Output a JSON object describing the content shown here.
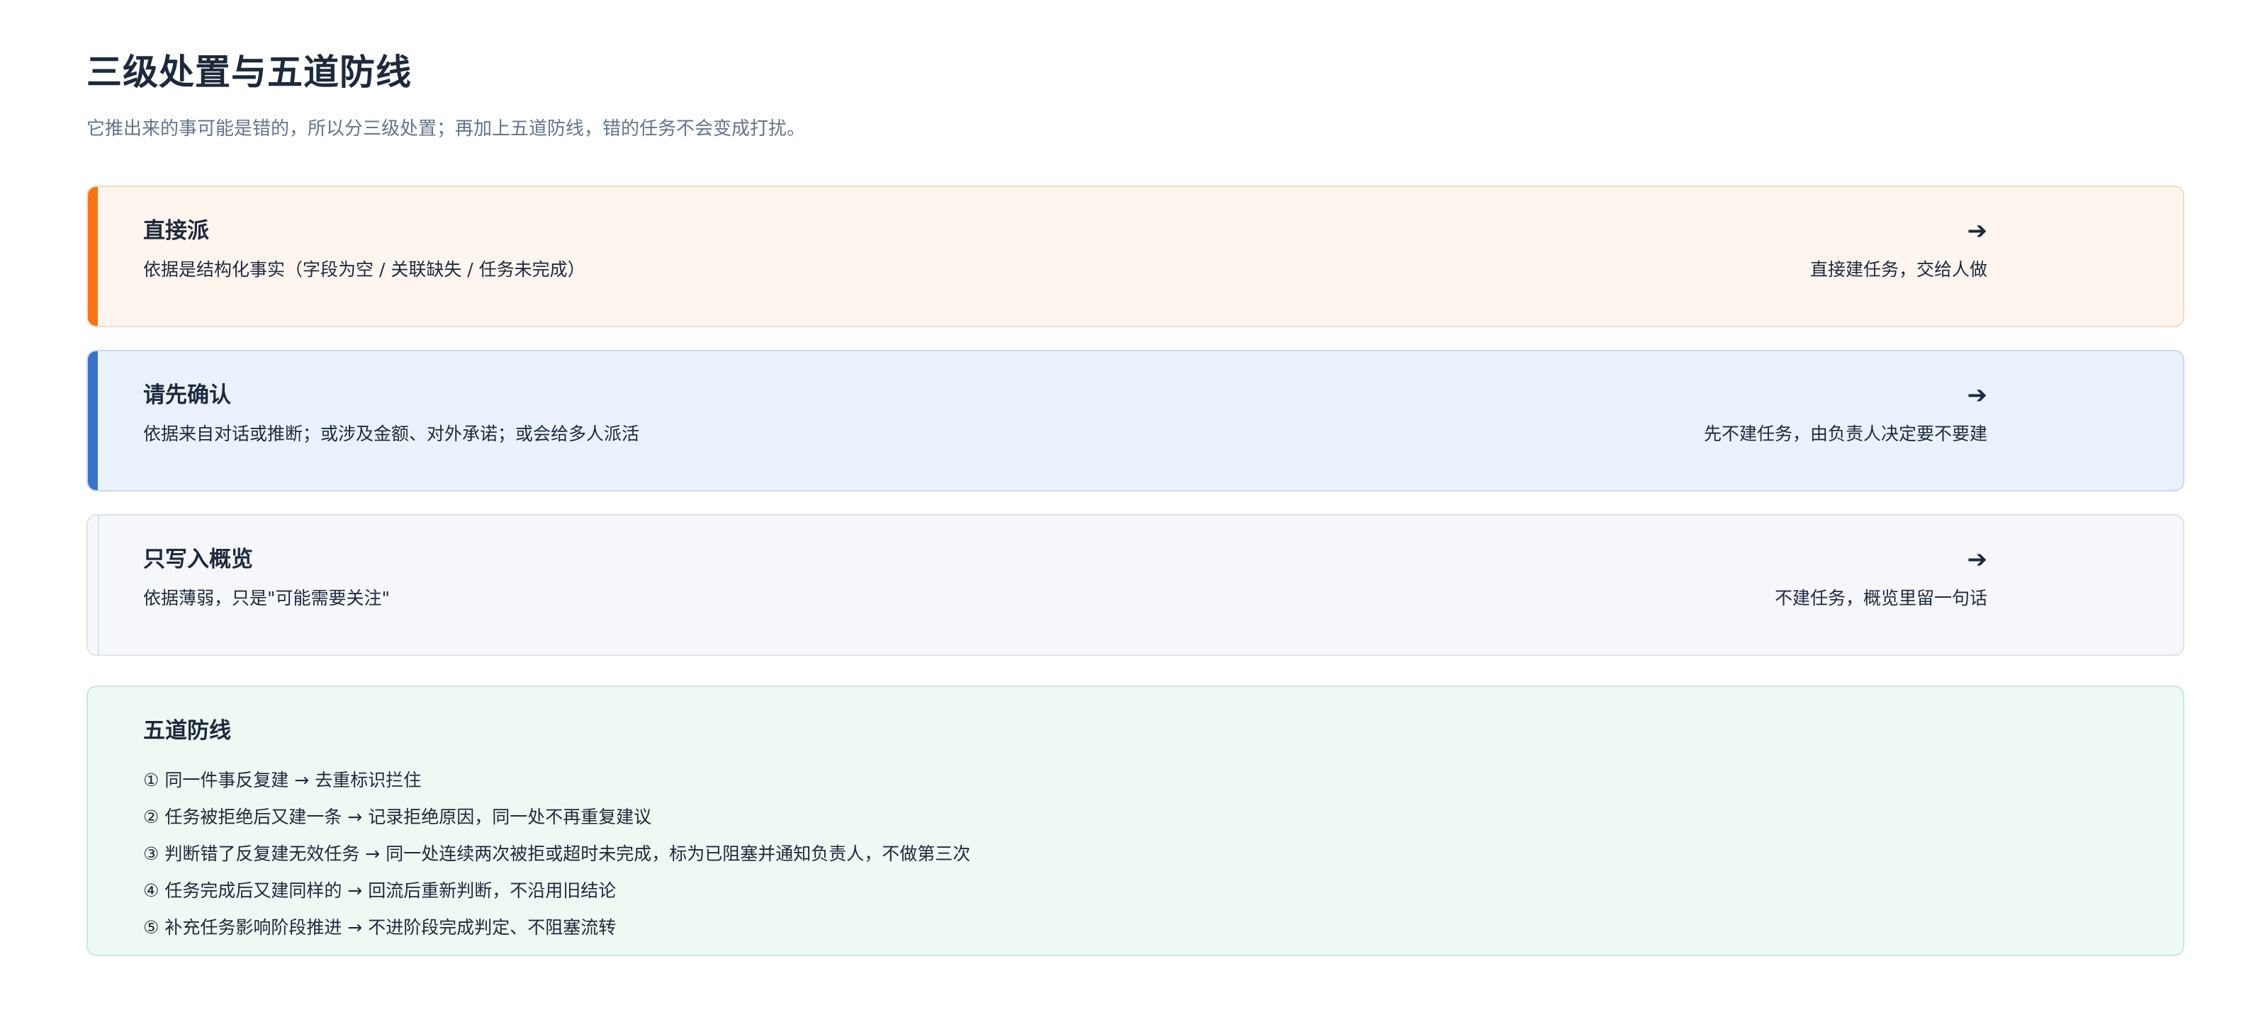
{
  "header": {
    "title": "三级处置与五道防线",
    "subtitle": "它推出来的事可能是错的，所以分三级处置；再加上五道防线，错的任务不会变成打扰。"
  },
  "tiers": [
    {
      "title": "直接派",
      "desc": "依据是结构化事实（字段为空 / 关联缺失 / 任务未完成）",
      "arrow": "➔",
      "action": "直接建任务，交给人做",
      "accent_color": "#f97316"
    },
    {
      "title": "请先确认",
      "desc": "依据来自对话或推断；或涉及金额、对外承诺；或会给多人派活",
      "arrow": "➔",
      "action": "先不建任务，由负责人决定要不要建",
      "accent_color": "#3a72c8"
    },
    {
      "title": "只写入概览",
      "desc": "依据薄弱，只是\"可能需要关注\"",
      "arrow": "➔",
      "action": "不建任务，概览里留一句话",
      "accent_color": "#dde3ec"
    }
  ],
  "defense": {
    "title": "五道防线",
    "items": [
      "① 同一件事反复建 → 去重标识拦住",
      "② 任务被拒绝后又建一条 → 记录拒绝原因，同一处不再重复建议",
      "③ 判断错了反复建无效任务 → 同一处连续两次被拒或超时未完成，标为已阻塞并通知负责人，不做第三次",
      "④ 任务完成后又建同样的 → 回流后重新判断，不沿用旧结论",
      "⑤ 补充任务影响阶段推进 → 不进阶段完成判定、不阻塞流转"
    ]
  }
}
